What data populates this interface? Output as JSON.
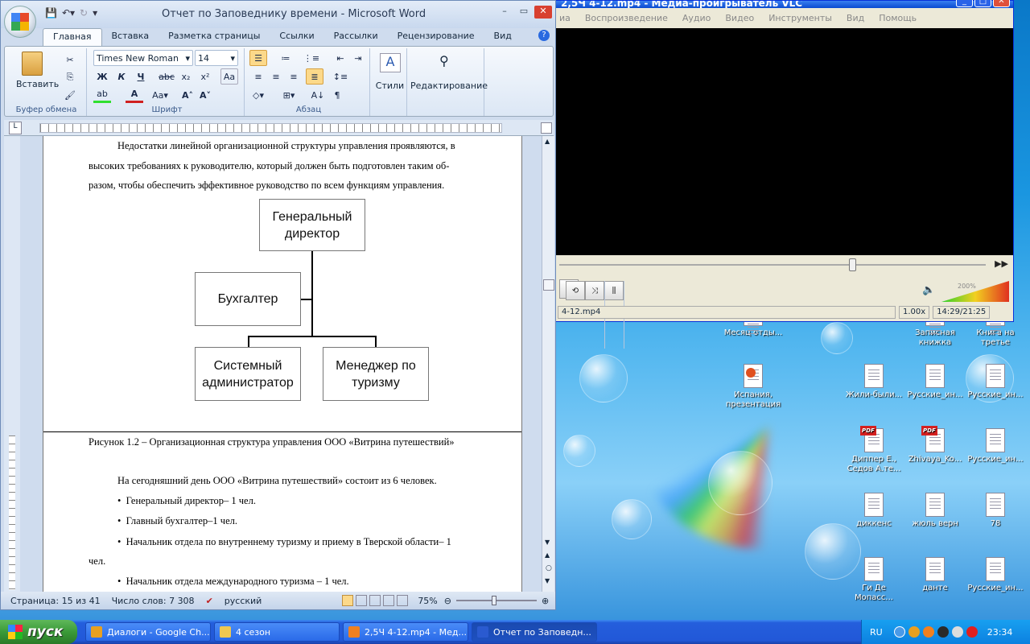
{
  "vlc": {
    "title": "2,5Ч 4-12.mp4 - Медиа-проигрыватель VLC",
    "menu": [
      "иа",
      "Воспроизведение",
      "Аудио",
      "Видео",
      "Инструменты",
      "Вид",
      "Помощь"
    ],
    "seek_fraction": 0.68,
    "volume_label": "200%",
    "status_file": "4-12.mp4",
    "speed": "1.00x",
    "time": "14:29/21:25"
  },
  "word": {
    "title": "Отчет по Заповеднику времени - Microsoft Word",
    "tabs": [
      "Главная",
      "Вставка",
      "Разметка страницы",
      "Ссылки",
      "Рассылки",
      "Рецензирование",
      "Вид"
    ],
    "font_name": "Times New Roman",
    "font_size": "14",
    "paste_label": "Вставить",
    "groups": {
      "clipboard": "Буфер обмена",
      "font": "Шрифт",
      "paragraph": "Абзац"
    },
    "styles_label": "Стили",
    "editing_label": "Редактирование",
    "format_buttons": {
      "bold": "Ж",
      "italic": "К",
      "underline": "Ч",
      "strike": "abc",
      "sub": "x₂",
      "sup": "x²"
    },
    "doc": {
      "para1": [
        "Недостатки линейной организационной структуры управления проявляются, в",
        "высоких требованиях к руководителю, который должен быть подготовлен таким об-",
        "разом, чтобы обеспечить эффективное руководство по всем функциям управления."
      ],
      "org": {
        "director": "Генеральный директор",
        "accountant": "Бухгалтер",
        "sysadmin": "Системный администратор",
        "manager": "Менеджер по туризму"
      },
      "caption": "Рисунок 1.2 – Организационная структура управления ООО «Витрина путешествий»",
      "para2": "На сегодняшний день ООО «Витрина путешествий» состоит из 6 человек.",
      "bullets": [
        "Генеральный директор– 1 чел.",
        "Главный бухгалтер–1 чел.",
        "Начальник отдела по внутреннему туризму и приему в Тверской области– 1",
        "Начальник отдела международного туризма – 1 чел."
      ],
      "bullet3_cont": "чел."
    },
    "status": {
      "page": "Страница: 15 из 41",
      "words": "Число слов: 7 308",
      "lang": "русский",
      "zoom": "75%"
    }
  },
  "desktop": {
    "icons": [
      {
        "label": "Месяц отды...",
        "kind": "doc"
      },
      {
        "label": "Записная книжка",
        "kind": "doc"
      },
      {
        "label": "Книга на третье",
        "kind": "doc"
      },
      {
        "label": "Испания, презентация",
        "kind": "ppt"
      },
      {
        "label": "Жили-были...",
        "kind": "doc"
      },
      {
        "label": "Русские_ин...",
        "kind": "doc"
      },
      {
        "label": "Русские_ин...",
        "kind": "doc"
      },
      {
        "label": "Диппер Е., Седов А.те...",
        "kind": "pdf"
      },
      {
        "label": "Zhivaya_Ko...",
        "kind": "pdf"
      },
      {
        "label": "Русские_ин...",
        "kind": "doc"
      },
      {
        "label": "диккенс",
        "kind": "doc"
      },
      {
        "label": "жюль верн",
        "kind": "doc"
      },
      {
        "label": "78",
        "kind": "doc"
      },
      {
        "label": "Ги Де Мопасс...",
        "kind": "doc"
      },
      {
        "label": "данте",
        "kind": "doc"
      },
      {
        "label": "Русские_ин...",
        "kind": "doc"
      }
    ]
  },
  "taskbar": {
    "start": "пуск",
    "tasks": [
      {
        "label": "Диалоги - Google Ch...",
        "color": "#e8a020"
      },
      {
        "label": "4 сезон",
        "color": "#f0c850"
      },
      {
        "label": "2,5Ч 4-12.mp4 - Мед...",
        "color": "#f08020"
      },
      {
        "label": "Отчет по Заповедн...",
        "color": "#2a5ad0"
      }
    ],
    "lang": "RU",
    "clock": "23:34"
  }
}
